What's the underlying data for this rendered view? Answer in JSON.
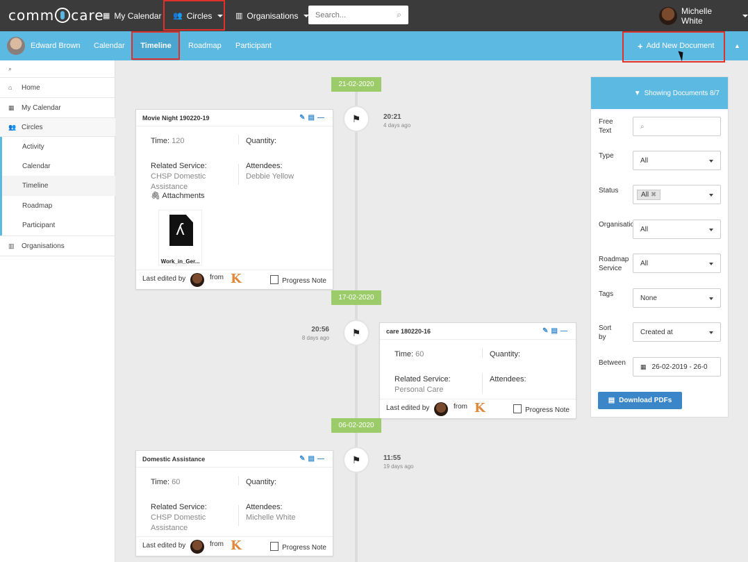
{
  "topbar": {
    "logo_text_left": "comm",
    "logo_text_right": "care",
    "nav": [
      {
        "label": "My Calendar",
        "icon": "calendar-icon"
      },
      {
        "label": "Circles",
        "icon": "users-icon"
      },
      {
        "label": "Organisations",
        "icon": "building-icon"
      }
    ],
    "search_placeholder": "Search...",
    "user_name": "Michelle White"
  },
  "subbar": {
    "client_name": "Edward Brown",
    "tabs": [
      "Calendar",
      "Timeline",
      "Roadmap",
      "Participant"
    ],
    "active_tab": "Timeline",
    "add_button": "Add New Document"
  },
  "sidebar": {
    "items": [
      {
        "label": "Home",
        "icon": "home-icon"
      },
      {
        "label": "My Calendar",
        "icon": "calendar-icon"
      },
      {
        "label": "Circles",
        "icon": "users-icon"
      },
      {
        "label": "Organisations",
        "icon": "building-icon"
      }
    ],
    "sub_items": [
      "Activity",
      "Calendar",
      "Timeline",
      "Roadmap",
      "Participant"
    ],
    "current_sub": "Timeline"
  },
  "timeline": {
    "entries": [
      {
        "date": "21-02-2020",
        "time": "20:21",
        "ago": "4 days ago",
        "title": "Movie Night 190220-19",
        "time_label": "Time:",
        "time_value": "120",
        "quantity_label": "Quantity:",
        "service_label": "Related Service:",
        "service_value": "CHSP Domestic Assistance",
        "attendees_label": "Attendees:",
        "attendees_value": "Debbie Yellow",
        "attachments_label": "Attachments",
        "attachment_name": "Work_in_Ger...",
        "last_edited_label": "Last edited by",
        "from_label": "from",
        "type": "Progress Note"
      },
      {
        "date": "17-02-2020",
        "time": "20:56",
        "ago": "8 days ago",
        "title": "care 180220-16",
        "time_label": "Time:",
        "time_value": "60",
        "quantity_label": "Quantity:",
        "service_label": "Related Service:",
        "service_value": "Personal Care",
        "attendees_label": "Attendees:",
        "attendees_value": "",
        "last_edited_label": "Last edited by",
        "from_label": "from",
        "type": "Progress Note"
      },
      {
        "date": "06-02-2020",
        "time": "11:55",
        "ago": "19 days ago",
        "title": "Domestic Assistance",
        "time_label": "Time:",
        "time_value": "60",
        "quantity_label": "Quantity:",
        "service_label": "Related Service:",
        "service_value": "CHSP Domestic Assistance",
        "attendees_label": "Attendees:",
        "attendees_value": "Michelle White",
        "last_edited_label": "Last edited by",
        "from_label": "from",
        "type": "Progress Note"
      }
    ]
  },
  "filters": {
    "header": "Showing Documents 8/7",
    "fields": [
      {
        "label": "Free Text",
        "value": ""
      },
      {
        "label": "Type",
        "value": "All"
      },
      {
        "label": "Status",
        "value": "All"
      },
      {
        "label": "Organisation",
        "value": "All"
      },
      {
        "label": "Roadmap Service",
        "value": "All"
      },
      {
        "label": "Tags",
        "value": "None"
      },
      {
        "label": "Sort by",
        "value": "Created at"
      },
      {
        "label": "Between",
        "value": "26-02-2019 - 26-0"
      }
    ],
    "download_button": "Download PDFs"
  },
  "colors": {
    "topbar": "#3b3b3b",
    "subbar": "#5cb9e2",
    "date_badge": "#9ccc6a",
    "primary_button": "#3a86c8",
    "highlight": "#e0302a"
  }
}
